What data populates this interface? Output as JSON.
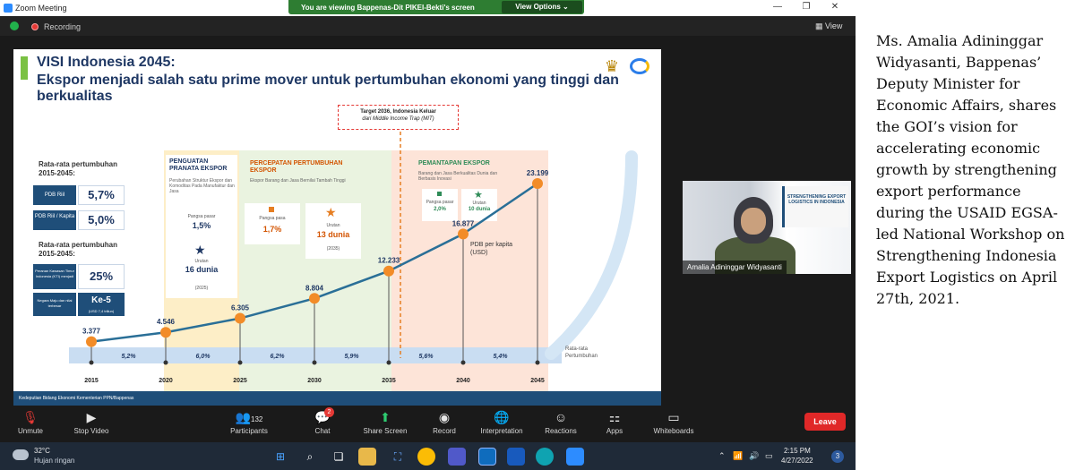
{
  "window": {
    "title": "Zoom Meeting",
    "share_banner": "You are viewing Bappenas-Dit PIKEI-Bekti's screen",
    "view_options": "View Options ⌄",
    "minimize": "—",
    "restore": "❐",
    "close": "✕"
  },
  "status": {
    "recording": "Recording",
    "view": "View"
  },
  "slide": {
    "title": "VISI Indonesia 2045:",
    "subtitle": "Ekspor menjadi salah satu prime mover untuk pertumbuhan ekonomi yang tinggi dan berkualitas",
    "target_line1": "Target 2036, Indonesia Keluar",
    "target_line2": "dari Middle Income Trap (MIT)",
    "growth_header_1": "Rata-rata pertumbuhan 2015-2045:",
    "growth_header_2": "Rata-rata pertumbuhan 2015-2045:",
    "pdb_riil_label": "PDB Riil",
    "pdb_riil_value": "5,7%",
    "pdb_kapita_label": "PDB Riil / Kapita",
    "pdb_kapita_value": "5,0%",
    "kti_label": "Peranan Kawasan Timur Indonesia (KTI) menjadi",
    "kti_value": "25%",
    "rank_label": "Negara Maju dan nilai terbesar",
    "rank_value": "Ke-5",
    "rank_note": "(USD 7,4 triliun)",
    "phases": [
      {
        "title": "PENGUATAN PRANATA EKSPOR",
        "note": "Perubahan Struktur Ekspor dan Komoditas Pada Manufaktur dan Jasa",
        "share_label": "Pangsa pasar",
        "share_value": "1,5%",
        "rank_label": "Urutan",
        "rank_value": "16 dunia",
        "year": "(2025)"
      },
      {
        "title": "PERCEPATAN PERTUMBUHAN EKSPOR",
        "note": "Ekspor Barang dan Jasa Bernilai Tambah Tinggi",
        "share_label": "Pangsa pasa",
        "share_value": "1,7%",
        "rank_label": "Urutan",
        "rank_value": "13 dunia",
        "year": "(2035)"
      },
      {
        "title": "PEMANTAPAN EKSPOR",
        "note": "Barang dan Jasa Berkualitas Dunia dan Berbasis Inovasi",
        "share_label": "Pangsa pasar",
        "share_value": "2,0%",
        "rank_label": "Urutan",
        "rank_value": "10 dunia",
        "year": ""
      }
    ],
    "pdb_label_1": "PDB per kapita",
    "pdb_label_2": "(USD)",
    "rata_label_1": "Rata-rata",
    "rata_label_2": "Pertumbuhan",
    "footer": "Kedeputian Bidang Ekonomi Kementerian PPN/Bappenas"
  },
  "chart_data": {
    "type": "line",
    "x": [
      "2015",
      "2020",
      "2025",
      "2030",
      "2035",
      "2040",
      "2045"
    ],
    "series": [
      {
        "name": "PDB per kapita",
        "values": [
          3377,
          4546,
          6305,
          8804,
          12233,
          16877,
          23199
        ]
      }
    ],
    "value_labels": [
      "3.377",
      "4.546",
      "6.305",
      "8.804",
      "12.233",
      "16.877",
      "23.199"
    ],
    "growth_labels": [
      "5,2%",
      "6,0%",
      "6,2%",
      "5,9%",
      "5,6%",
      "5,4%"
    ],
    "ylim": [
      0,
      25000
    ],
    "xlabel": "",
    "ylabel": "(USD)",
    "line_color": "#2a6f97",
    "marker_color": "#f28c28"
  },
  "video": {
    "name": "Amalia Adininggar Widyasanti",
    "banner": "STRENGTHENING EXPORT LOGISTICS IN INDONESIA"
  },
  "toolbar": {
    "unmute": "Unmute",
    "stop_video": "Stop Video",
    "participants": "Participants",
    "participants_count": "132",
    "chat": "Chat",
    "chat_badge": "2",
    "share_screen": "Share Screen",
    "record": "Record",
    "interpretation": "Interpretation",
    "reactions": "Reactions",
    "apps": "Apps",
    "whiteboards": "Whiteboards",
    "leave": "Leave"
  },
  "taskbar": {
    "temp": "32°C",
    "weather": "Hujan ringan",
    "time": "2:15 PM",
    "date": "4/27/2022",
    "notifications": "3"
  },
  "caption": "Ms. Amalia Adininggar Widyasanti, Bappenas’ Deputy Minister for Economic Affairs, shares the GOI’s vision for accelerating economic growth by strengthening export performance during the USAID EGSA-led National Workshop on Strengthening Indonesia Export Logistics on April 27th, 2021.",
  "colors": {
    "zoom_bg": "#1a1a1a",
    "share_green": "#2e7d32",
    "leave_red": "#e02828",
    "slide_navy": "#1f3864"
  }
}
